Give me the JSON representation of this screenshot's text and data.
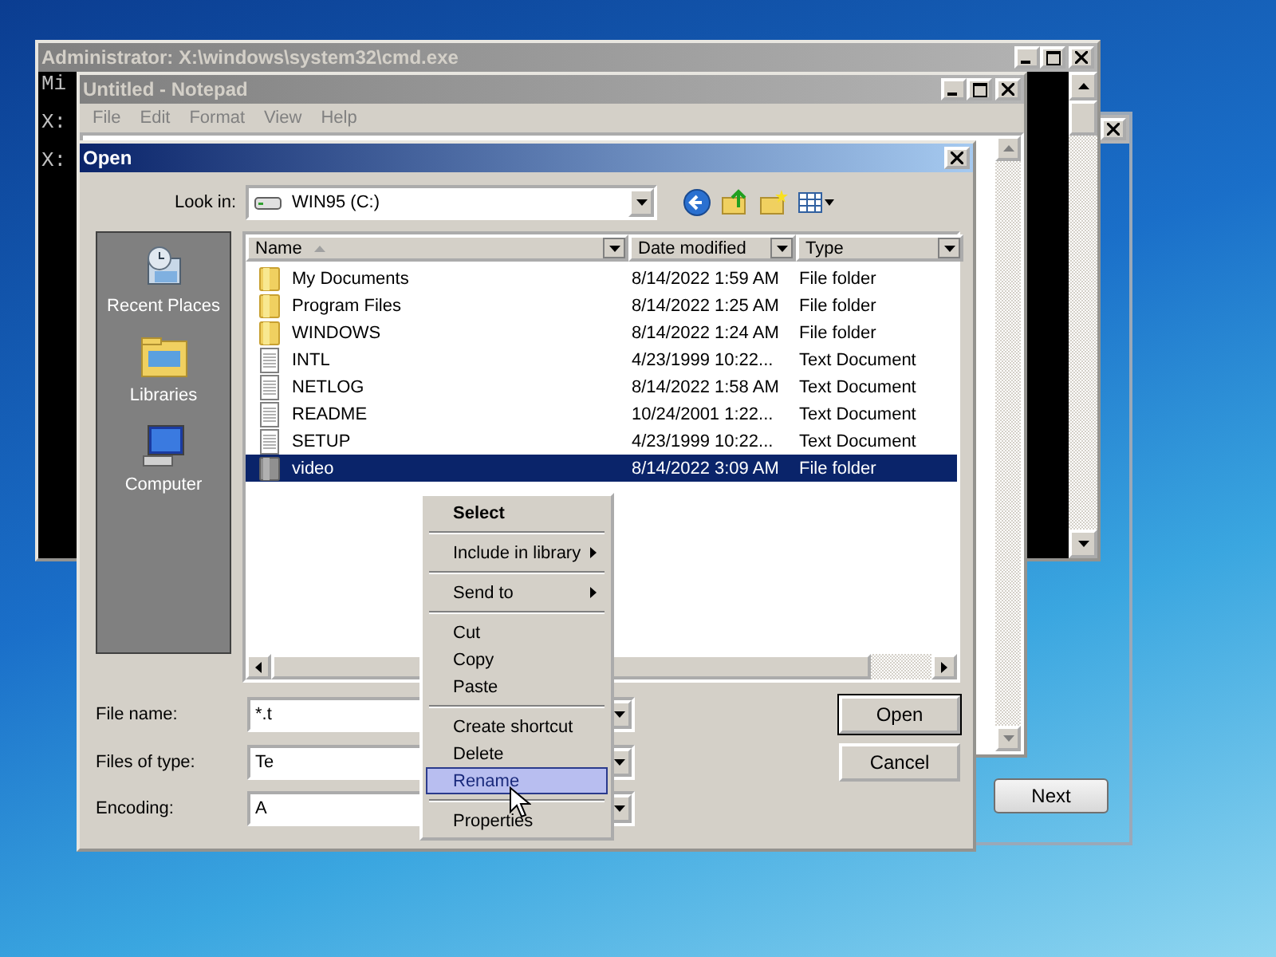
{
  "setup_window": {
    "button": "Next"
  },
  "console_window": {
    "title": "Administrator: X:\\windows\\system32\\cmd.exe",
    "lines": [
      "Mi",
      "X:",
      "X:"
    ]
  },
  "notepad_window": {
    "title": "Untitled - Notepad",
    "menu": [
      "File",
      "Edit",
      "Format",
      "View",
      "Help"
    ]
  },
  "open_dialog": {
    "title": "Open",
    "look_in": {
      "label": "Look in:",
      "value": "WIN95 (C:)"
    },
    "places": [
      {
        "kind": "recent",
        "label": "Recent Places"
      },
      {
        "kind": "libraries",
        "label": "Libraries"
      },
      {
        "kind": "computer",
        "label": "Computer"
      }
    ],
    "columns": [
      {
        "label": "Name",
        "sorted": true
      },
      {
        "label": "Date modified",
        "sorted": false
      },
      {
        "label": "Type",
        "sorted": false
      }
    ],
    "rows": [
      {
        "kind": "folder",
        "name": "My Documents",
        "date": "8/14/2022 1:59 AM",
        "type": "File folder",
        "selected": false
      },
      {
        "kind": "folder",
        "name": "Program Files",
        "date": "8/14/2022 1:25 AM",
        "type": "File folder",
        "selected": false
      },
      {
        "kind": "folder",
        "name": "WINDOWS",
        "date": "8/14/2022 1:24 AM",
        "type": "File folder",
        "selected": false
      },
      {
        "kind": "document",
        "name": "INTL",
        "date": "4/23/1999 10:22...",
        "type": "Text Document",
        "selected": false
      },
      {
        "kind": "document",
        "name": "NETLOG",
        "date": "8/14/2022 1:58 AM",
        "type": "Text Document",
        "selected": false
      },
      {
        "kind": "document",
        "name": "README",
        "date": "10/24/2001 1:22...",
        "type": "Text Document",
        "selected": false
      },
      {
        "kind": "document",
        "name": "SETUP",
        "date": "4/23/1999 10:22...",
        "type": "Text Document",
        "selected": false
      },
      {
        "kind": "grey-folder",
        "name": "video",
        "date": "8/14/2022 3:09 AM",
        "type": "File folder",
        "selected": true
      }
    ],
    "fields": [
      {
        "label": "File name:",
        "value": "*.t"
      },
      {
        "label": "Files of type:",
        "value": "Te"
      },
      {
        "label": "Encoding:",
        "value": "A"
      }
    ],
    "buttons": [
      {
        "label": "Open",
        "default": true
      },
      {
        "label": "Cancel",
        "default": false
      }
    ]
  },
  "context_menu": {
    "items": [
      {
        "kind": "item",
        "label": "Select",
        "default": true,
        "submenu": false,
        "selected": false
      },
      {
        "kind": "separator"
      },
      {
        "kind": "item",
        "label": "Include in library",
        "default": false,
        "submenu": true,
        "selected": false
      },
      {
        "kind": "separator"
      },
      {
        "kind": "item",
        "label": "Send to",
        "default": false,
        "submenu": true,
        "selected": false
      },
      {
        "kind": "separator"
      },
      {
        "kind": "item",
        "label": "Cut",
        "default": false,
        "submenu": false,
        "selected": false
      },
      {
        "kind": "item",
        "label": "Copy",
        "default": false,
        "submenu": false,
        "selected": false
      },
      {
        "kind": "item",
        "label": "Paste",
        "default": false,
        "submenu": false,
        "selected": false
      },
      {
        "kind": "separator"
      },
      {
        "kind": "item",
        "label": "Create shortcut",
        "default": false,
        "submenu": false,
        "selected": false
      },
      {
        "kind": "item",
        "label": "Delete",
        "default": false,
        "submenu": false,
        "selected": false
      },
      {
        "kind": "item",
        "label": "Rename",
        "default": false,
        "submenu": false,
        "selected": true
      },
      {
        "kind": "separator"
      },
      {
        "kind": "item",
        "label": "Properties",
        "default": false,
        "submenu": false,
        "selected": false
      }
    ]
  }
}
